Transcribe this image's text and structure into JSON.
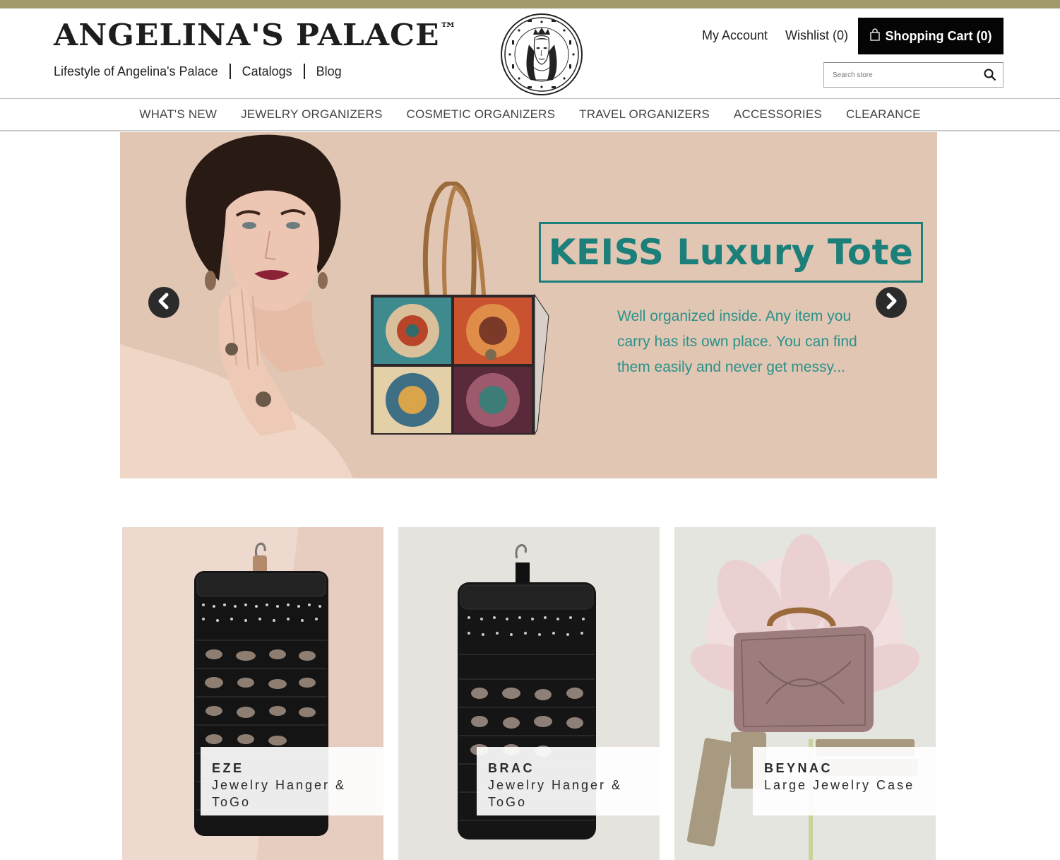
{
  "header": {
    "brand": "ANGELINA'S PALACE",
    "brand_tm": "™",
    "sublinks": [
      "Lifestyle of Angelina's Palace",
      "Catalogs",
      "Blog"
    ],
    "my_account": "My Account",
    "wishlist": "Wishlist (0)",
    "cart": "Shopping Cart (0)",
    "search_placeholder": "Search store"
  },
  "nav": {
    "items": [
      "WHAT'S NEW",
      "JEWELRY ORGANIZERS",
      "COSMETIC ORGANIZERS",
      "TRAVEL ORGANIZERS",
      "ACCESSORIES",
      "CLEARANCE"
    ]
  },
  "hero": {
    "title": "KEISS Luxury Tote",
    "description": "Well organized inside. Any item you carry has its own place. You can find them easily and never get messy...",
    "background": "#e2c6b4",
    "accent": "#1c7f7a"
  },
  "products": [
    {
      "name": "EZE",
      "subtitle": "Jewelry Hanger & ToGo"
    },
    {
      "name": "BRAC",
      "subtitle": "Jewelry Hanger & ToGo"
    },
    {
      "name": "BEYNAC",
      "subtitle": "Large Jewelry Case"
    }
  ],
  "colors": {
    "topbar": "#a29a6a",
    "cart_bg": "#050505"
  },
  "icons": [
    "bag-icon",
    "search-icon",
    "arrow-left-icon",
    "arrow-right-icon"
  ]
}
